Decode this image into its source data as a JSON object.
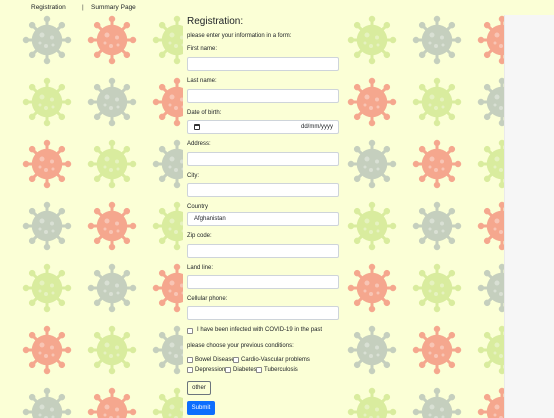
{
  "nav": {
    "registration": "Registration",
    "separator": "|",
    "summary": "Summary Page"
  },
  "form": {
    "title": "Registration:",
    "subtitle": "please enter your information in a form:",
    "fields": {
      "first_name": {
        "label": "First name:",
        "value": ""
      },
      "last_name": {
        "label": "Last name:",
        "value": ""
      },
      "dob": {
        "label": "Date of birth:",
        "placeholder": "dd/mm/yyyy"
      },
      "address": {
        "label": "Address:",
        "value": ""
      },
      "city": {
        "label": "City:",
        "value": ""
      },
      "country": {
        "label": "Country",
        "value": "Afghanistan"
      },
      "zip": {
        "label": "Zip code:",
        "value": ""
      },
      "landline": {
        "label": "Land line:",
        "value": ""
      },
      "cellular": {
        "label": "Cellular phone:",
        "value": ""
      }
    },
    "covid_label": "I have been infected with COVID-19 in the past",
    "conditions_label": "please choose your previous conditions:",
    "conditions": [
      "Bowel Disease",
      "Cardio-Vascular problems",
      "Depression",
      "Diabetes",
      "Tuberculosis"
    ],
    "other_button": "other",
    "submit_button": "Submit"
  },
  "virus_colors": [
    "#c5cfbe",
    "#f5a78e",
    "#d9ec9e"
  ]
}
